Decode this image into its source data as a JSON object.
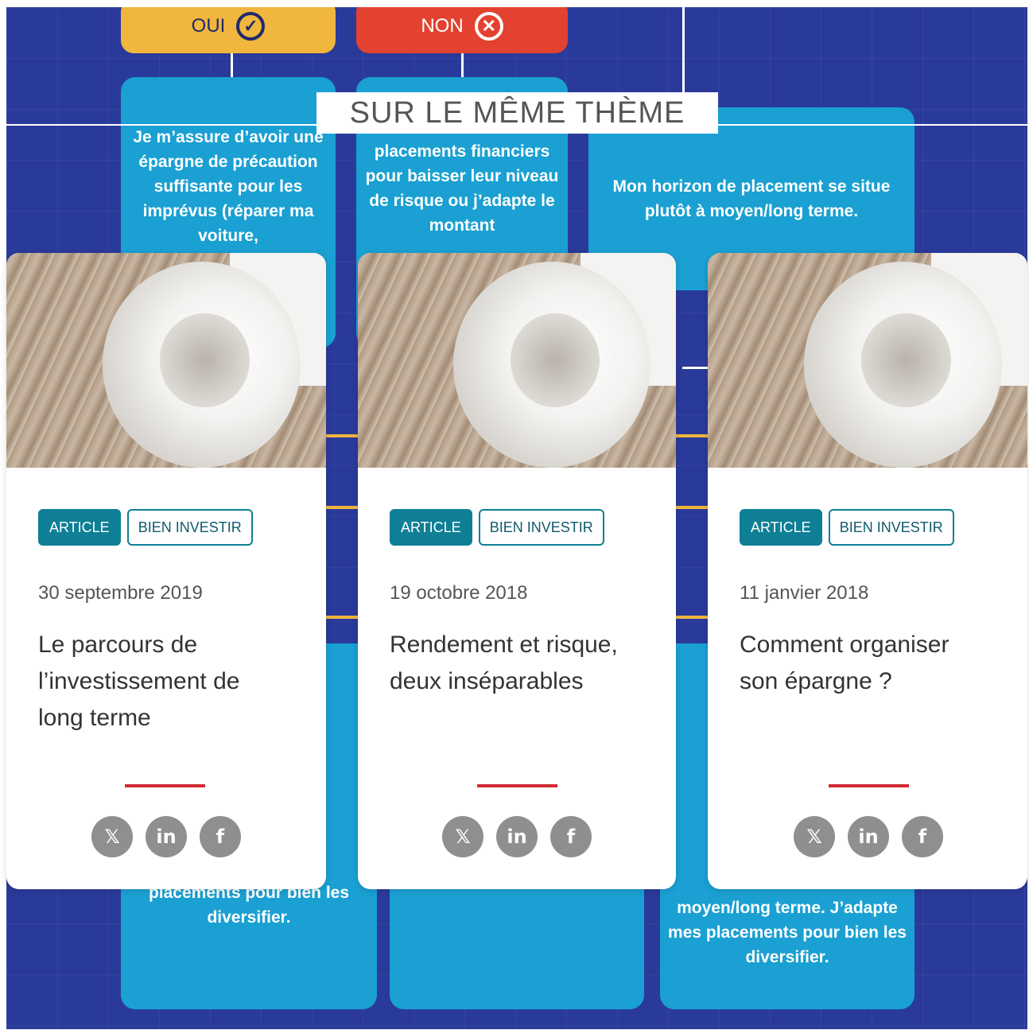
{
  "section": {
    "title": "SUR LE MÊME THÈME"
  },
  "background": {
    "oui_label": "OUI",
    "non_label": "NON",
    "box_left_text": "Je m’assure d’avoir une épargne de précaution suffisante pour les imprévus (réparer ma voiture,",
    "box_mid_text": "placements financiers pour baisser leur niveau de risque ou j’adapte le montant",
    "box_right_text": "Mon horizon de placement se situe plutôt à moyen/long terme.",
    "box_bottom_left_text": "placements pour bien les diversifier.",
    "box_bottom_right_text": "moyen/long terme. J’adapte mes placements pour bien les diversifier."
  },
  "cards": [
    {
      "tag_type": "ARTICLE",
      "tag_category": "BIEN INVESTIR",
      "date": "30 septembre 2019",
      "title": "Le parcours de l’investissement de long terme"
    },
    {
      "tag_type": "ARTICLE",
      "tag_category": "BIEN INVESTIR",
      "date": "19 octobre 2018",
      "title": "Rendement et risque, deux inséparables"
    },
    {
      "tag_type": "ARTICLE",
      "tag_category": "BIEN INVESTIR",
      "date": "11 janvier 2018",
      "title": "Comment organiser son épargne ?"
    }
  ],
  "share_icons": {
    "x": "𝕏",
    "linkedin": "in",
    "facebook": "f"
  },
  "colors": {
    "accent_teal": "#0e7f95",
    "divider_red": "#d12a35",
    "icon_gray": "#8f8f8f"
  }
}
